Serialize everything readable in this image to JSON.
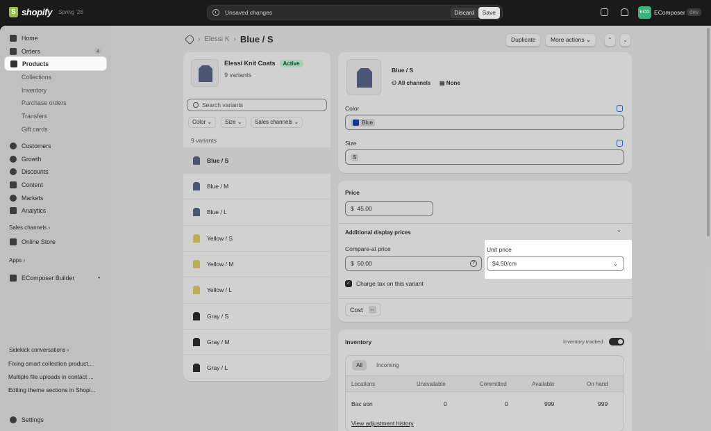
{
  "topbar": {
    "logo": "shopify",
    "edition": "Spring '26",
    "unsaved": "Unsaved changes",
    "discard": "Discard",
    "save": "Save",
    "store_initials": "ECO",
    "store_name": "EComposer",
    "dev_badge": "dev"
  },
  "sidebar": {
    "items": [
      {
        "label": "Home"
      },
      {
        "label": "Orders",
        "badge": "4"
      },
      {
        "label": "Products"
      },
      {
        "label": "Collections"
      },
      {
        "label": "Inventory"
      },
      {
        "label": "Purchase orders"
      },
      {
        "label": "Transfers"
      },
      {
        "label": "Gift cards"
      },
      {
        "label": "Customers"
      },
      {
        "label": "Growth"
      },
      {
        "label": "Discounts"
      },
      {
        "label": "Content"
      },
      {
        "label": "Markets"
      },
      {
        "label": "Analytics"
      }
    ],
    "sales_channels": "Sales channels",
    "online_store": "Online Store",
    "apps": "Apps",
    "ecomposer": "EComposer Builder",
    "sidekick": "Sidekick conversations",
    "conversations": [
      "Fixing smart collection product...",
      "Multiple file uploads in contact ...",
      "Editing theme sections in Shopi..."
    ],
    "settings": "Settings"
  },
  "header": {
    "breadcrumb_product": "Elessi K",
    "title": "Blue / S",
    "duplicate": "Duplicate",
    "more_actions": "More actions"
  },
  "product": {
    "name": "Elessi Knit Coats",
    "status": "Active",
    "variant_count": "9 variants",
    "search_placeholder": "Search variants",
    "filters": [
      "Color",
      "Size",
      "Sales channels"
    ],
    "list_count": "9 variants",
    "variants": [
      "Blue / S",
      "Blue / M",
      "Blue / L",
      "Yellow / S",
      "Yellow / M",
      "Yellow / L",
      "Gray / S",
      "Gray / M",
      "Gray / L"
    ]
  },
  "variant": {
    "title": "Blue / S",
    "channels": "All channels",
    "catalogs": "None",
    "color_label": "Color",
    "color_value": "Blue",
    "size_label": "Size",
    "size_value": "S"
  },
  "pricing": {
    "price_label": "Price",
    "currency": "$",
    "price": "45.00",
    "additional_label": "Additional display prices",
    "compare_label": "Compare-at price",
    "compare_value": "50.00",
    "unit_label": "Unit price",
    "unit_value": "$4.50/cm",
    "charge_tax": "Charge tax on this variant",
    "cost_label": "Cost",
    "cost_value": "--"
  },
  "inventory": {
    "title": "Inventory",
    "tracked_label": "Inventory tracked",
    "tabs": [
      "All",
      "Incoming"
    ],
    "columns": [
      "Locations",
      "Unavailable",
      "Committed",
      "Available",
      "On hand"
    ],
    "row": [
      "Bac son",
      "0",
      "0",
      "999",
      "999"
    ],
    "history_link": "View adjustment history"
  },
  "colors": {
    "accent_green": "#36b37e",
    "active_badge": "#cdfee1",
    "blue_swatch": "#1f3fb8"
  }
}
